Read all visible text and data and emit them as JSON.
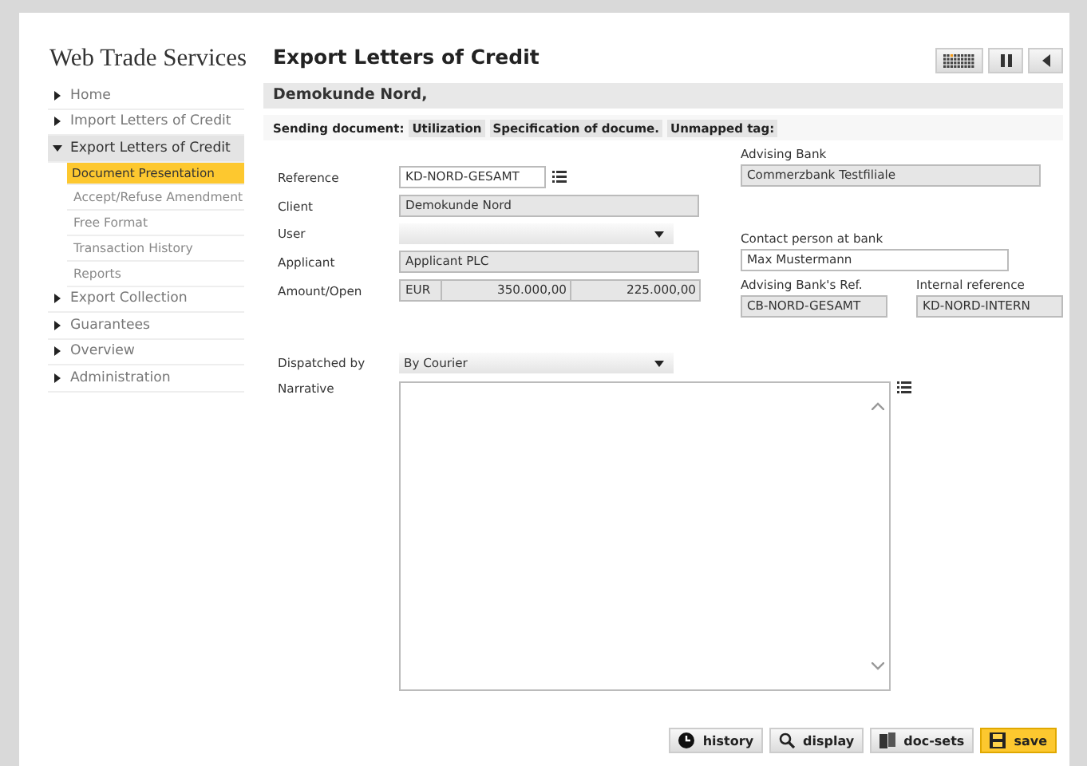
{
  "app_title": "Web Trade Services",
  "page_title": "Export Letters of Credit",
  "toolbar": [
    {
      "kind": "grid"
    },
    {
      "kind": "pause"
    },
    {
      "kind": "back"
    }
  ],
  "sidebar": {
    "items": [
      {
        "label": "Home",
        "expanded": false
      },
      {
        "label": "Import Letters of Credit",
        "expanded": false
      },
      {
        "label": "Export Letters of Credit",
        "expanded": true,
        "children": [
          {
            "label": "Document Presentation",
            "selected": true
          },
          {
            "label": "Accept/Refuse Amendment",
            "selected": false
          },
          {
            "label": "Free Format",
            "selected": false
          },
          {
            "label": "Transaction History",
            "selected": false
          },
          {
            "label": "Reports",
            "selected": false
          }
        ]
      },
      {
        "label": "Export Collection",
        "expanded": false
      },
      {
        "label": "Guarantees",
        "expanded": false
      },
      {
        "label": "Overview",
        "expanded": false
      },
      {
        "label": "Administration",
        "expanded": false
      }
    ]
  },
  "customer": "Demokunde Nord,",
  "sending": {
    "label": "Sending document:",
    "tags": [
      "Utilization",
      "Specification of docume.",
      "Unmapped tag:"
    ]
  },
  "form": {
    "reference": {
      "label": "Reference",
      "value": "KD-NORD-GESAMT"
    },
    "client": {
      "label": "Client",
      "value": "Demokunde Nord"
    },
    "user": {
      "label": "User"
    },
    "applicant": {
      "label": "Applicant",
      "value": "Applicant PLC"
    },
    "amount": {
      "label": "Amount/Open",
      "currency": "EUR",
      "amount": "350.000,00",
      "open": "225.000,00"
    },
    "advising_bank": {
      "label": "Advising Bank",
      "value": "Commerzbank Testfiliale"
    },
    "contact": {
      "label": "Contact person at bank",
      "value": "Max Mustermann"
    },
    "advising_ref": {
      "label": "Advising Bank's Ref.",
      "value": "CB-NORD-GESAMT"
    },
    "internal_ref": {
      "label": "Internal reference",
      "value": "KD-NORD-INTERN"
    },
    "dispatched": {
      "label": "Dispatched by",
      "value": "By Courier"
    },
    "narrative": {
      "label": "Narrative"
    }
  },
  "buttons": [
    {
      "kind": "history",
      "label": "history"
    },
    {
      "kind": "display",
      "label": "display"
    },
    {
      "kind": "docsets",
      "label": "doc-sets"
    },
    {
      "kind": "save",
      "label": "save"
    }
  ]
}
